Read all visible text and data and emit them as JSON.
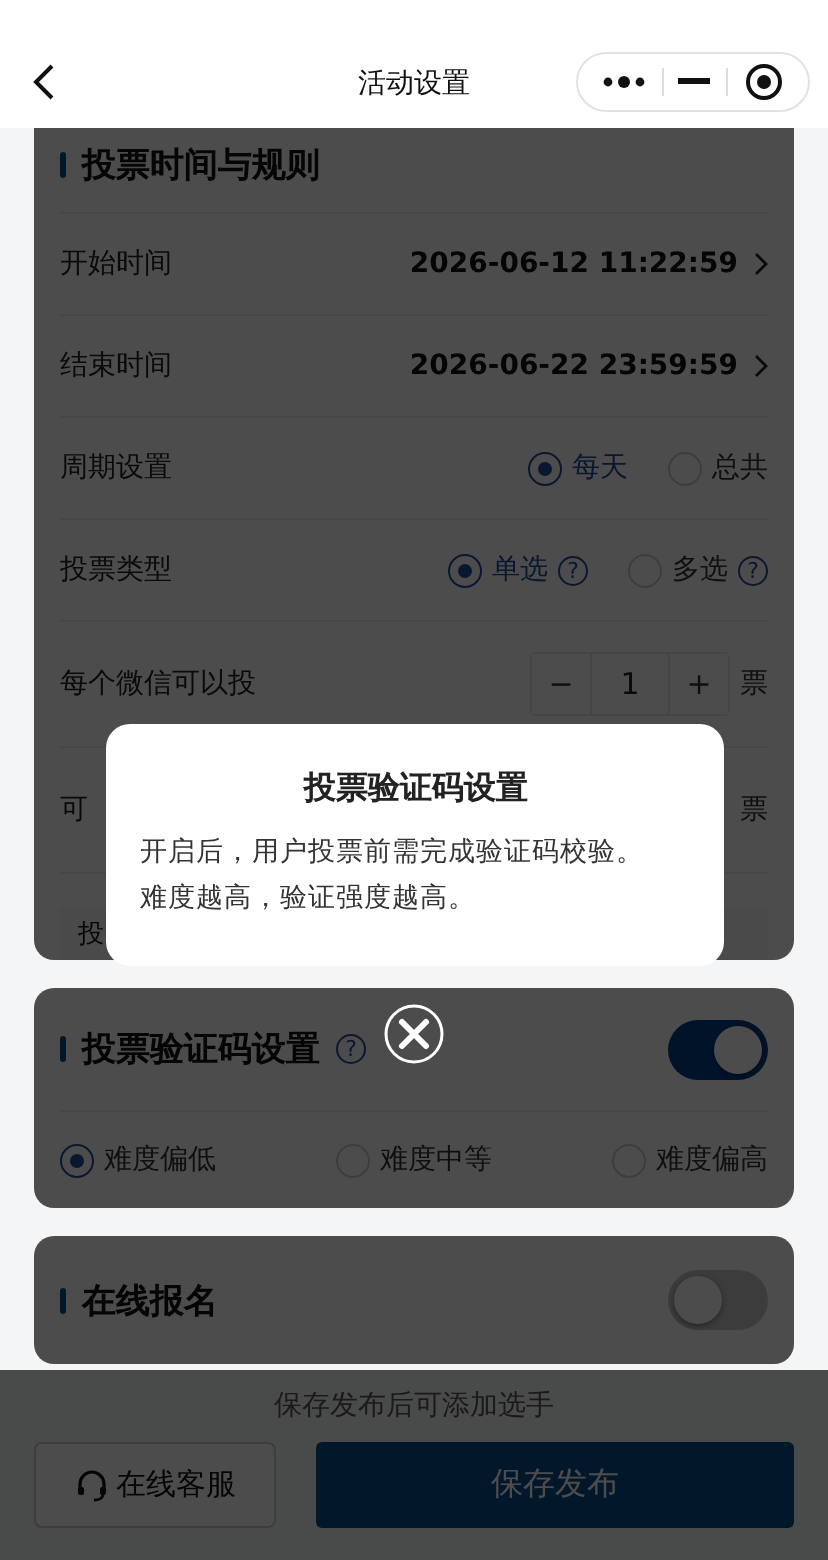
{
  "nav": {
    "title": "活动设置"
  },
  "sections": [
    {
      "kind": "rules",
      "title": "投票时间与规则",
      "rows": [
        {
          "kind": "value",
          "label": "开始时间",
          "value": "2026-06-12 11:22:59"
        },
        {
          "kind": "value",
          "label": "结束时间",
          "value": "2026-06-22 23:59:59"
        },
        {
          "kind": "radio",
          "label": "周期设置",
          "options": [
            {
              "label": "每天",
              "selected": true
            },
            {
              "label": "总共",
              "selected": false
            }
          ]
        },
        {
          "kind": "radio",
          "label": "投票类型",
          "options": [
            {
              "label": "单选",
              "selected": true,
              "help": "?"
            },
            {
              "label": "多选",
              "selected": false,
              "help": "?"
            }
          ]
        },
        {
          "kind": "stepper",
          "label": "每个微信可以投",
          "minus": "−",
          "value": "1",
          "plus": "+",
          "unit": "票"
        },
        {
          "kind": "covered",
          "label": "可",
          "unit": "票"
        },
        {
          "kind": "button",
          "label": "投"
        }
      ]
    },
    {
      "kind": "captcha",
      "title": "投票验证码设置",
      "help": "?",
      "on": true,
      "options": [
        {
          "label": "难度偏低",
          "selected": true
        },
        {
          "label": "难度中等",
          "selected": false
        },
        {
          "label": "难度偏高",
          "selected": false
        }
      ]
    },
    {
      "kind": "signup",
      "title": "在线报名",
      "on": false
    }
  ],
  "footer": {
    "hint": "保存发布后可添加选手",
    "service_button": "在线客服",
    "publish_button": "保存发布"
  },
  "modal": {
    "title": "投票验证码设置",
    "text": "开启后，用户投票前需完成验证码校验。难度越高，验证强度越高。"
  }
}
